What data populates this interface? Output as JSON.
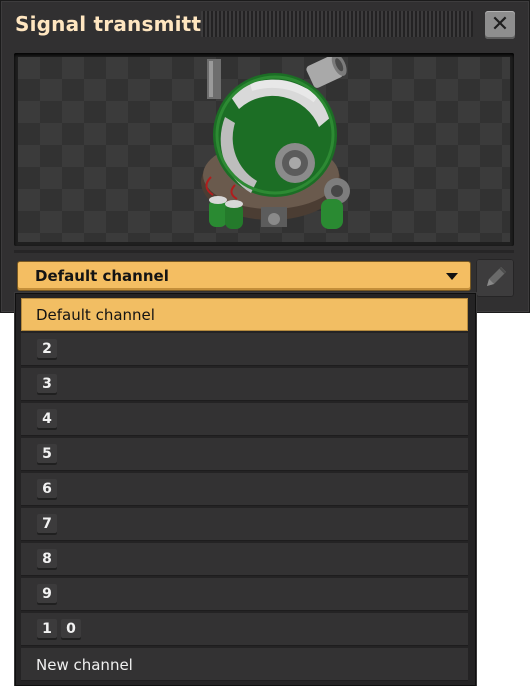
{
  "window": {
    "title": "Signal transmitter",
    "close_icon": "close-icon"
  },
  "preview": {
    "entity": "radar-transmitter-image"
  },
  "dropdown": {
    "selected": "Default channel",
    "caret_icon": "caret-down-icon",
    "edit_icon": "pencil-icon"
  },
  "list": {
    "default_item": "Default channel",
    "numbered_items": [
      {
        "digits": [
          "2"
        ]
      },
      {
        "digits": [
          "3"
        ]
      },
      {
        "digits": [
          "4"
        ]
      },
      {
        "digits": [
          "5"
        ]
      },
      {
        "digits": [
          "6"
        ]
      },
      {
        "digits": [
          "7"
        ]
      },
      {
        "digits": [
          "8"
        ]
      },
      {
        "digits": [
          "9"
        ]
      },
      {
        "digits": [
          "1",
          "0"
        ]
      }
    ],
    "new_item": "New channel"
  },
  "colors": {
    "accent": "#f4be62",
    "panel": "#313031",
    "title": "#ffe6c0"
  }
}
